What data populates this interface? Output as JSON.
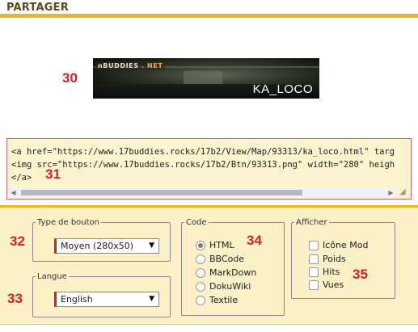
{
  "header": {
    "title": "PARTAGER"
  },
  "callouts": {
    "banner": "30",
    "code": "31",
    "button_type": "32",
    "language": "33",
    "code_format": "34",
    "display": "35"
  },
  "banner": {
    "logo_main": "nBUDDIES",
    "logo_net": ". NET",
    "map_name": "KA_LOCO"
  },
  "code_box": {
    "lines": [
      "<a href=\"https://www.17buddies.rocks/17b2/View/Map/93313/ka_loco.html\" targ",
      "<img src=\"https://www.17buddies.rocks/17b2/Btn/93313.png\" width=\"280\" heigh",
      "</a>"
    ]
  },
  "button_type": {
    "legend": "Type de bouton",
    "selected": "Moyen (280x50)"
  },
  "language": {
    "legend": "Langue",
    "selected": "English"
  },
  "code_format": {
    "legend": "Code",
    "options": [
      {
        "label": "HTML",
        "checked": true
      },
      {
        "label": "BBCode",
        "checked": false
      },
      {
        "label": "MarkDown",
        "checked": false
      },
      {
        "label": "DokuWiki",
        "checked": false
      },
      {
        "label": "Textile",
        "checked": false
      }
    ]
  },
  "display": {
    "legend": "Afficher",
    "options": [
      {
        "label": "Icône Mod",
        "checked": false
      },
      {
        "label": "Poids",
        "checked": false
      },
      {
        "label": "Hits",
        "checked": false
      },
      {
        "label": "Vues",
        "checked": false
      }
    ]
  },
  "colors": {
    "accent": "#e8b921",
    "callout": "#d91f1f",
    "panel_bg": "#fbf0c8",
    "code_bg": "#fbf3cd"
  }
}
